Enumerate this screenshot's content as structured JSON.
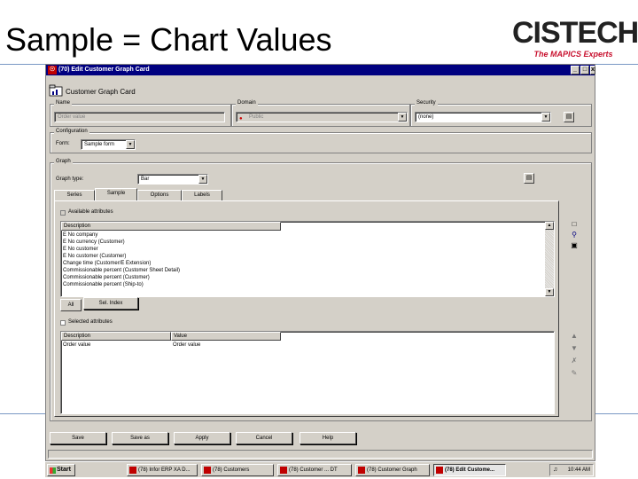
{
  "slide": {
    "title": "Sample = Chart Values",
    "logo_text": "CISTECH",
    "logo_tagline": "The MAPICS Experts"
  },
  "window": {
    "title": "(70) Edit Customer Graph Card",
    "icon_glyph": "☉",
    "controls": {
      "minimize": "_",
      "maximize": "□",
      "close": "x"
    },
    "card_title": "Customer Graph Card"
  },
  "form": {
    "name": {
      "label": "Name",
      "value": "Order value"
    },
    "domain": {
      "label": "Domain",
      "value": "Public"
    },
    "security": {
      "label": "Security",
      "value": "(none)"
    },
    "configuration": {
      "label": "Configuration",
      "sublabel": "Form:",
      "value": "Sample form"
    },
    "graph": {
      "label": "Graph",
      "type_label": "Graph type:",
      "type_value": "Bar"
    }
  },
  "tabs": [
    {
      "label": "Series"
    },
    {
      "label": "Sample"
    },
    {
      "label": "Options"
    },
    {
      "label": "Labels"
    }
  ],
  "sample": {
    "available_label": "Available attributes",
    "description_header": "Description",
    "attributes": [
      "E No company",
      "E No currency (Customer)",
      "E No customer",
      "E No customer (Customer)",
      "Change time (Customer/E Extension)",
      "Commissionable percent (Customer Sheet Detail)",
      "Commissionable percent (Customer)",
      "Commissionable percent (Ship-to)"
    ],
    "all_button": "All",
    "selected_button": "Sel. Index",
    "selected_label": "Selected attributes",
    "col_description": "Description",
    "col_value": "Value",
    "selected_rows": [
      {
        "description": "Order value",
        "value": "Order value"
      }
    ]
  },
  "buttons": {
    "save": "Save",
    "save_as": "Save as",
    "apply": "Apply",
    "cancel": "Cancel",
    "help": "Help"
  },
  "taskbar": {
    "start": "Start",
    "tasks": [
      {
        "label": "(78) Infor ERP XA D..."
      },
      {
        "label": "(78) Customers"
      },
      {
        "label": "(78) Customer ... DT"
      },
      {
        "label": "(78) Customer Graph"
      },
      {
        "label": "(78) Edit Custome..."
      }
    ],
    "clock": "10:44 AM"
  }
}
